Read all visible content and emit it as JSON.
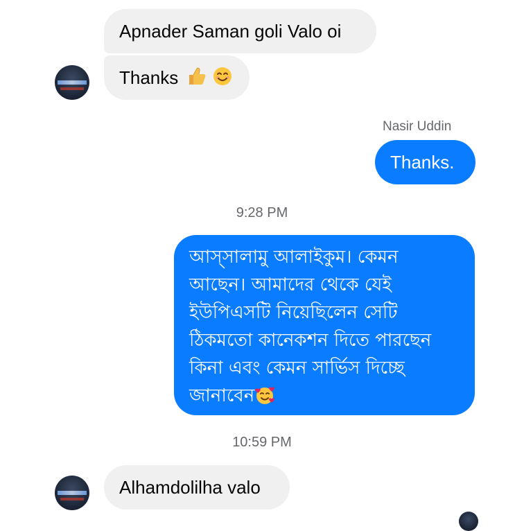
{
  "thread": {
    "messages": [
      {
        "text": "Apnader Saman goli Valo oi"
      },
      {
        "text": "Thanks"
      },
      {
        "sender": "Nasir Uddin",
        "text": "Thanks."
      },
      {
        "time": "9:28 PM"
      },
      {
        "lines": [
          "আস্সালামু আলাইকুম। কেমন",
          "আছেন। আমাদের থেকে যেই",
          "ইউপিএসটি নিয়েছিলেন সেটি",
          "ঠিকমতো কানেকশন দিতে পারছেন",
          "কিনা এবং কেমন সার্ভিস দিচ্ছে",
          "জানাবেন"
        ]
      },
      {
        "time": "10:59 PM"
      },
      {
        "text": "Alhamdolilha valo"
      }
    ]
  },
  "colors": {
    "incoming_bubble": "#f0f0f0",
    "outgoing_bubble": "#0a7cff",
    "timestamp_text": "#65676b"
  },
  "icons": [
    "thumbs-up-emoji",
    "smiling-face-emoji",
    "smiling-face-with-hearts-emoji",
    "contact-avatar"
  ]
}
